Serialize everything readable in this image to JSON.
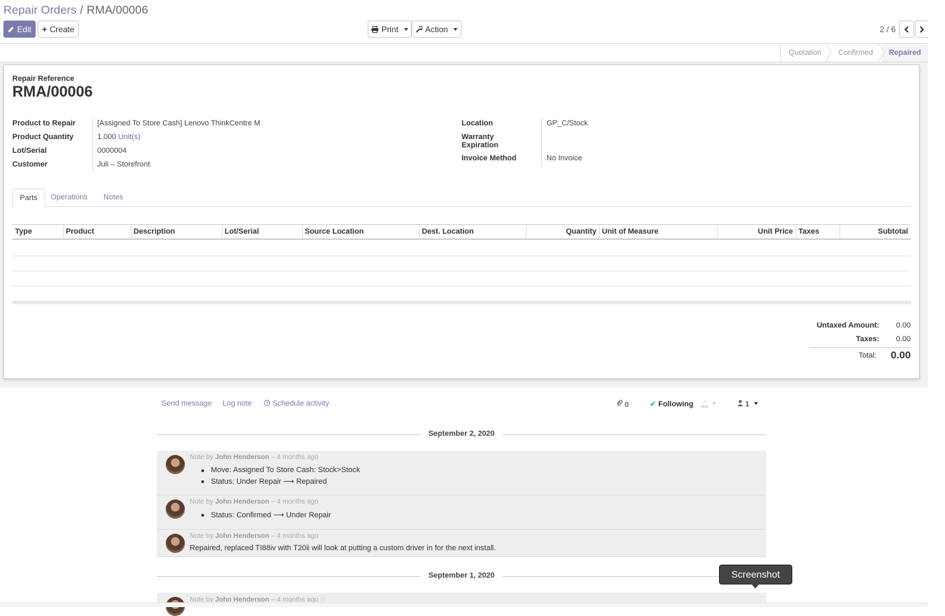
{
  "breadcrumb": {
    "parent": "Repair Orders",
    "separator": "/",
    "current": "RMA/00006"
  },
  "buttons": {
    "edit": "Edit",
    "create": "Create",
    "print": "Print",
    "action": "Action"
  },
  "pager": {
    "value": "2 / 6"
  },
  "statusbar": {
    "stages": [
      "Quotation",
      "Confirmed",
      "Repaired"
    ],
    "active": "Repaired"
  },
  "form": {
    "ref_label": "Repair Reference",
    "ref_value": "RMA/00006",
    "left_fields": [
      {
        "label": "Product to Repair",
        "value": "[Assigned To Store Cash] Lenovo ThinkCentre M"
      },
      {
        "label": "Product Quantity",
        "value": "1.000",
        "unit": "Unit(s)"
      },
      {
        "label": "Lot/Serial",
        "value": "0000004"
      },
      {
        "label": "Customer",
        "value": "Juli – Storefront"
      }
    ],
    "right_fields": [
      {
        "label": "Location",
        "value": "GP_C/Stock"
      },
      {
        "label": "Warranty",
        "label2": "Expiration",
        "value": ""
      },
      {
        "label": "Invoice Method",
        "value": "No Invoice"
      }
    ]
  },
  "tabs": [
    "Parts",
    "Operations",
    "Notes"
  ],
  "table": {
    "columns": [
      "Type",
      "Product",
      "Description",
      "Lot/Serial",
      "Source Location",
      "Dest. Location",
      "Quantity",
      "Unit of Measure",
      "Unit Price",
      "Taxes",
      "Subtotal"
    ]
  },
  "totals": {
    "untaxed_label": "Untaxed Amount:",
    "untaxed_value": "0.00",
    "taxes_label": "Taxes:",
    "taxes_value": "0.00",
    "total_label": "Total:",
    "total_value": "0.00"
  },
  "chatter": {
    "send_message": "Send message",
    "log_note": "Log note",
    "schedule_activity": "Schedule activity",
    "attachments_count": "0",
    "following": "Following",
    "followers_count": "1",
    "date1": "September 2, 2020",
    "date2": "September 1, 2020",
    "messages": [
      {
        "prefix": "Note by",
        "author": "John Henderson",
        "time": "– 4 months ago",
        "items": [
          "Move: Assigned To Store Cash: Stock>Stock",
          "Status: Under Repair ⟶ Repaired"
        ]
      },
      {
        "prefix": "Note by",
        "author": "John Henderson",
        "time": "– 4 months ago",
        "items": [
          "Status: Confirmed ⟶ Under Repair"
        ]
      },
      {
        "prefix": "Note by",
        "author": "John Henderson",
        "time": "– 4 months ago",
        "text": "Repaired, replaced TI88iv with T20ii will look at putting a custom driver in for the next install."
      },
      {
        "prefix": "Note by",
        "author": "John Henderson",
        "time": "– 4 months ago"
      }
    ]
  },
  "tooltip": "Screenshot",
  "colors": {
    "primary": "#7c7bad",
    "link": "#6b6aa0"
  }
}
